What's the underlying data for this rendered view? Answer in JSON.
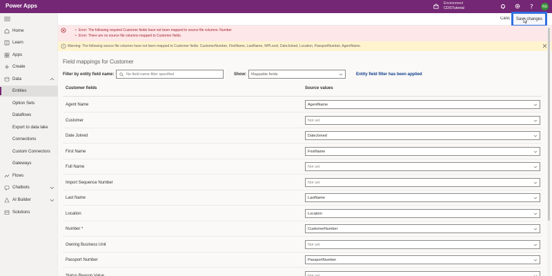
{
  "app": {
    "title": "Power Apps"
  },
  "environment": {
    "label": "Environment",
    "name": "CDSTutorial"
  },
  "user": {
    "initials": "NS"
  },
  "sidebar": {
    "items": [
      {
        "label": "Home"
      },
      {
        "label": "Learn"
      },
      {
        "label": "Apps"
      },
      {
        "label": "Create"
      },
      {
        "label": "Data"
      },
      {
        "label": "Entities"
      },
      {
        "label": "Option Sets"
      },
      {
        "label": "Dataflows"
      },
      {
        "label": "Export to data lake"
      },
      {
        "label": "Connections"
      },
      {
        "label": "Custom Connectors"
      },
      {
        "label": "Gateways"
      },
      {
        "label": "Flows"
      },
      {
        "label": "Chatbots"
      },
      {
        "label": "AI Builder"
      },
      {
        "label": "Solutions"
      }
    ]
  },
  "commands": {
    "cancel": "Cancel",
    "save": "Save changes"
  },
  "errors": [
    "Error: The following required Customer fields have not been mapped to source file columns: Number",
    "Error: There are no source file columns mapped to Customer fields."
  ],
  "warning": "Warning: The following source file columns have not been mapped to Customer fields: CustomerNumber, FirstName, LastName, WPLevel, DateJoined, Location, PassportNumber, AgentName.",
  "page": {
    "title": "Field mappings for Customer",
    "filter_label": "Filter by entity field name:",
    "filter_placeholder": "No field name filter specified",
    "show_label": "Show:",
    "show_value": "Mappable fields",
    "filter_applied": "Entity field filter has been applied",
    "col_customer_fields": "Customer fields",
    "col_source_values": "Source values"
  },
  "mappings": [
    {
      "field": "Agent Name",
      "source": "AgentName",
      "set": true
    },
    {
      "field": "Customer",
      "source": "Not set",
      "set": false
    },
    {
      "field": "Date Joined",
      "source": "DateJoined",
      "set": true
    },
    {
      "field": "First Name",
      "source": "FirstName",
      "set": true
    },
    {
      "field": "Full Name",
      "source": "Not set",
      "set": false
    },
    {
      "field": "Import Sequence Number",
      "source": "Not set",
      "set": false
    },
    {
      "field": "Last Name",
      "source": "LastName",
      "set": true
    },
    {
      "field": "Location",
      "source": "Location",
      "set": true
    },
    {
      "field": "Number *",
      "source": "CustomerNumber",
      "set": true
    },
    {
      "field": "Owning Business Unit",
      "source": "Not set",
      "set": false
    },
    {
      "field": "Passport Number",
      "source": "PassportNumber",
      "set": true
    },
    {
      "field": "Status Reason Value",
      "source": "Not set",
      "set": false
    }
  ],
  "colors": {
    "brand": "#742774",
    "highlight": "#2f6fe0",
    "error_bg": "#fde7e9",
    "warning_bg": "#fff4ce",
    "link": "#0f3d8a"
  }
}
